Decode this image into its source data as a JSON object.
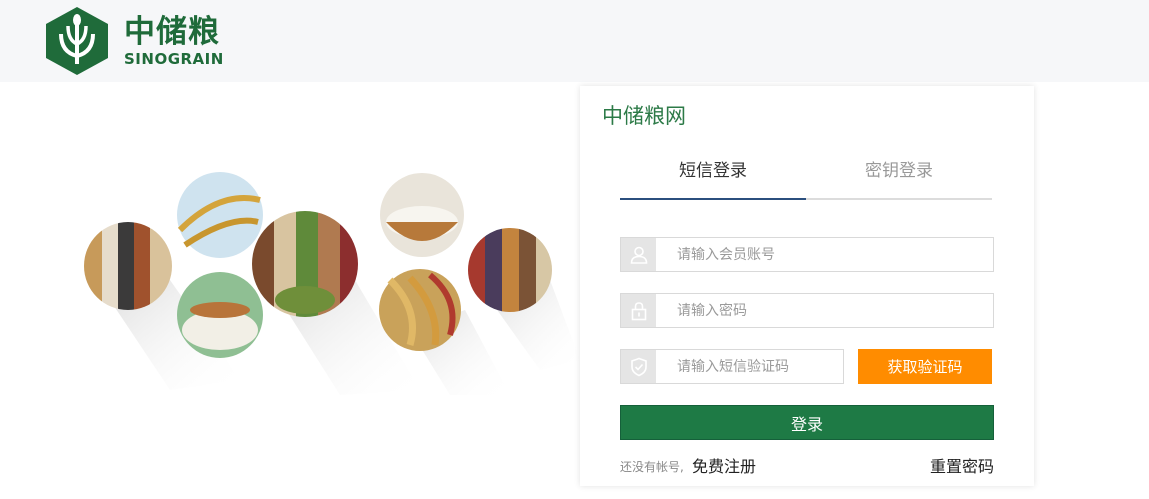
{
  "brand": {
    "name_cn": "中储粮",
    "name_en": "SINOGRAIN",
    "color": "#1f6b3a"
  },
  "panel": {
    "title": "中储粮网",
    "tabs": [
      {
        "label": "短信登录",
        "active": true
      },
      {
        "label": "密钥登录",
        "active": false
      }
    ],
    "account": {
      "placeholder": "请输入会员账号",
      "icon": "user-icon"
    },
    "password": {
      "placeholder": "请输入密码",
      "icon": "lock-icon"
    },
    "sms_code": {
      "placeholder": "请输入短信验证码",
      "icon": "shield-icon"
    },
    "get_code_label": "获取验证码",
    "login_label": "登录",
    "no_account_text": "还没有帐号,",
    "register_label": "免费注册",
    "reset_label": "重置密码"
  },
  "colors": {
    "accent_orange": "#ff8c00",
    "login_green": "#1e7a45",
    "tab_underline": "#2b4f7e"
  }
}
